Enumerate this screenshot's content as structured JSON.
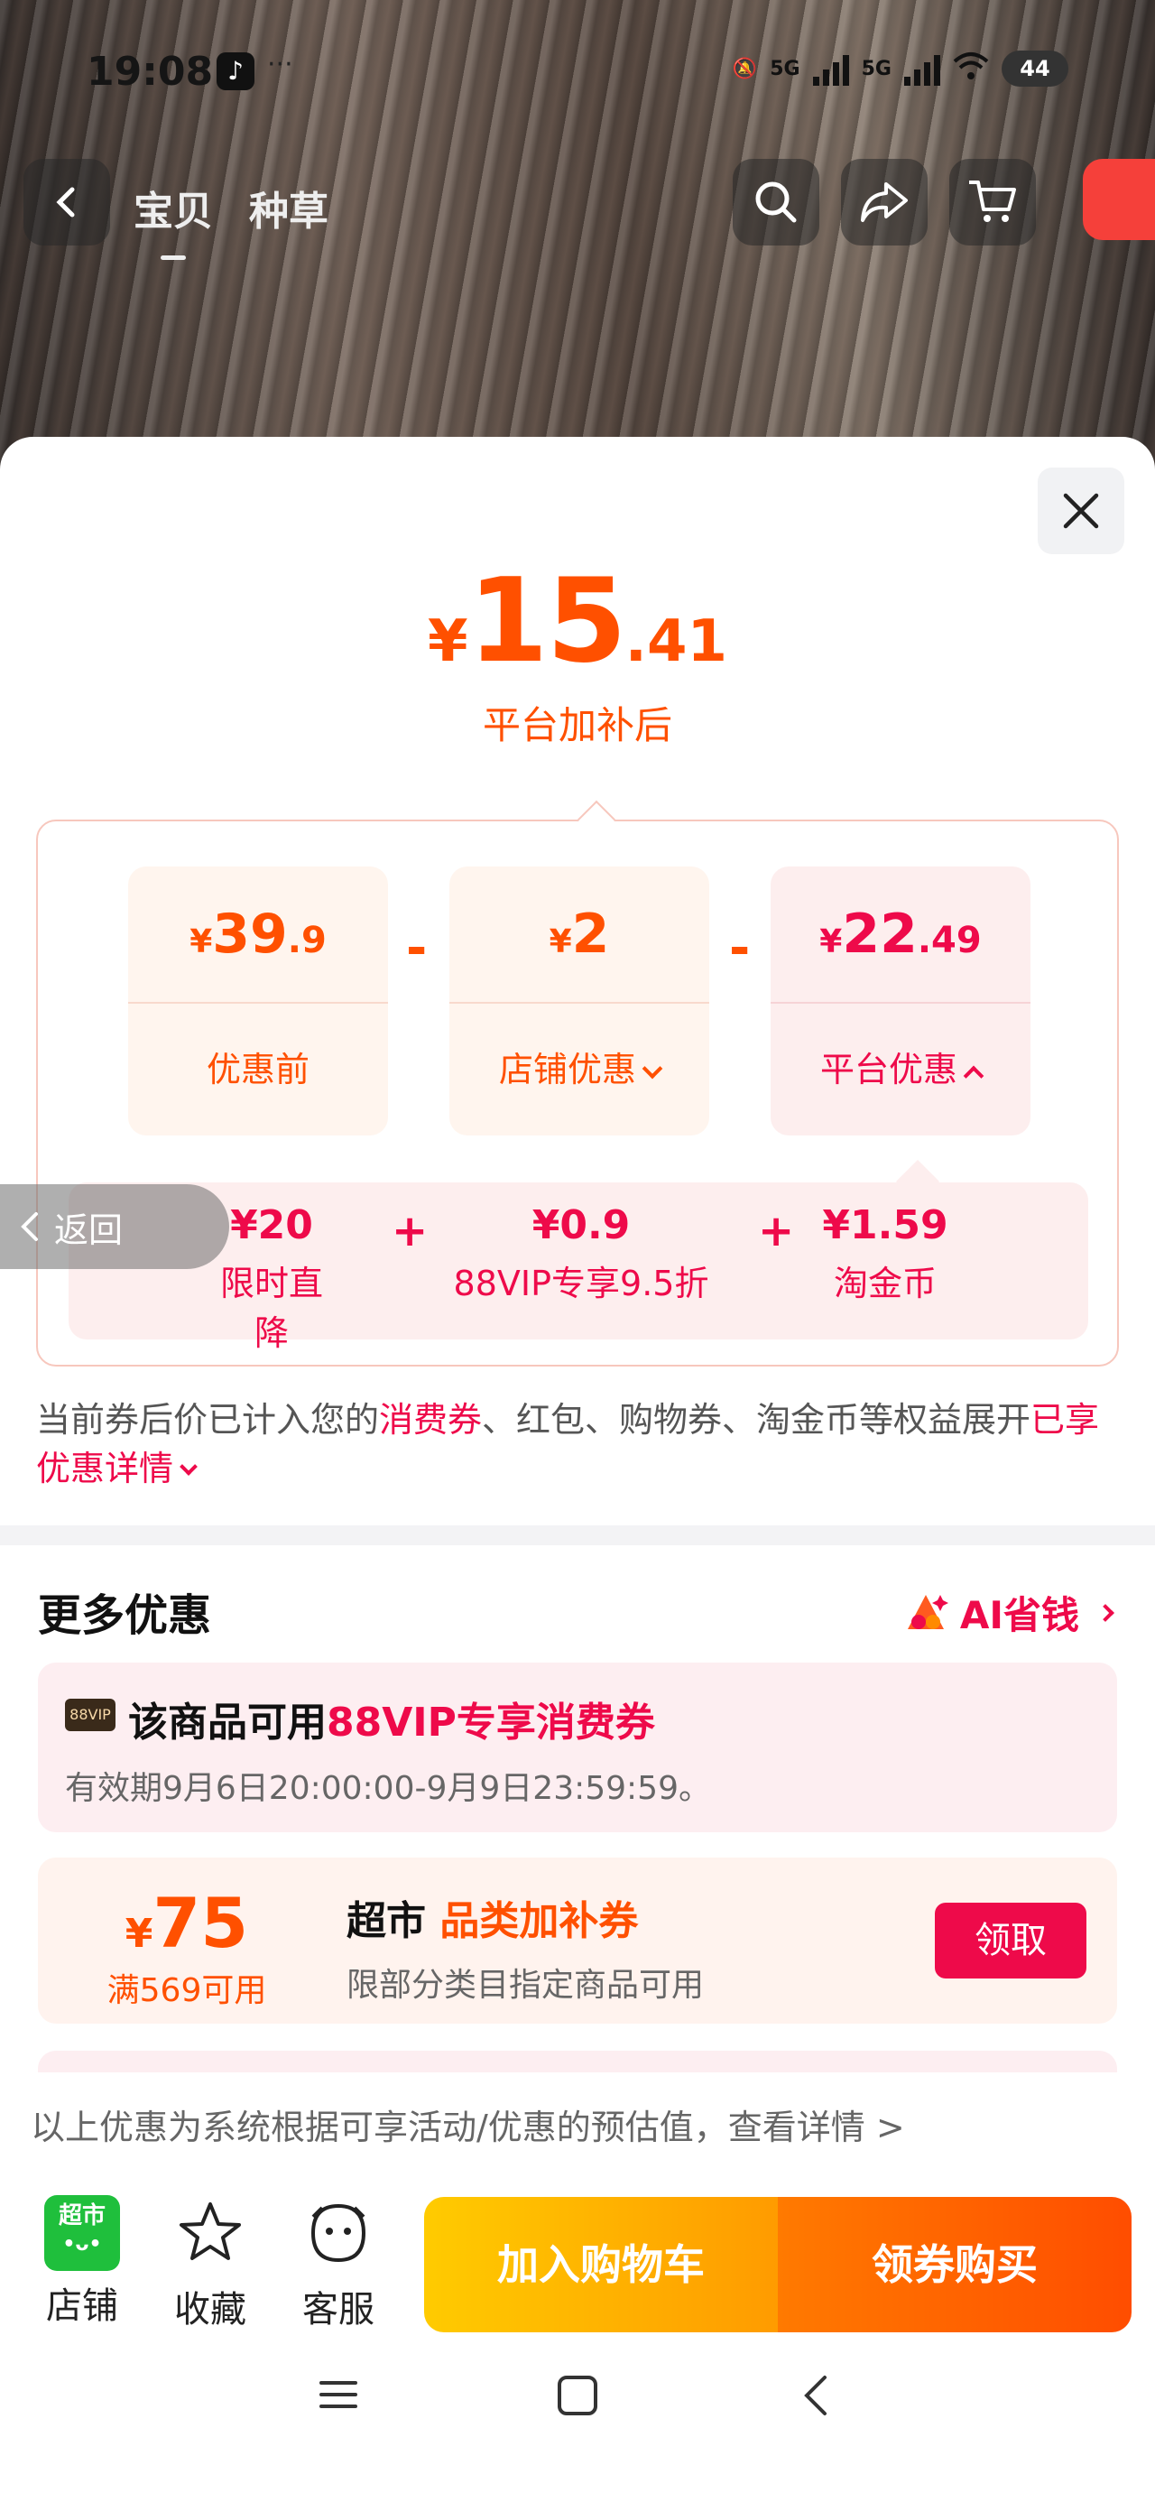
{
  "status_bar": {
    "time": "19:08",
    "app_icon": "tiktok-icon",
    "dots": "···",
    "net1": "5G",
    "net2": "5G",
    "battery": "44"
  },
  "nav": {
    "tab_item": "宝贝",
    "tab_grass": "种草"
  },
  "sheet": {
    "final_price": {
      "symbol": "¥",
      "integer": "15",
      "decimal": ".41",
      "label": "平台加补后"
    },
    "breakdown": {
      "original": {
        "symbol": "¥",
        "integer": "39",
        "decimal": ".9",
        "label": "优惠前"
      },
      "shop_discount": {
        "symbol": "¥",
        "integer": "2",
        "decimal": "",
        "label": "店铺优惠"
      },
      "platform_discount": {
        "symbol": "¥",
        "integer": "22",
        "decimal": ".49",
        "label": "平台优惠"
      },
      "minus": "-",
      "platform_items": [
        {
          "value": "¥20",
          "label": "限时直降"
        },
        {
          "value": "¥0.9",
          "label": "88VIP专享9.5折"
        },
        {
          "value": "¥1.59",
          "label": "淘金币"
        }
      ],
      "plus": "+"
    },
    "note": {
      "prefix": "当前券后价已计入您的",
      "highlight": "消费券",
      "middle": "、红包、购物券、淘金币等权益展开",
      "link": "已享优惠详情"
    },
    "more": {
      "title": "更多优惠",
      "ai_label": "AI省钱"
    },
    "back_label": "返回",
    "vip_coupon": {
      "tag": "88VIP",
      "title_prefix": "该商品可用",
      "title_highlight": "88VIP专享消费券",
      "validity": "有效期9月6日20:00:00-9月9日23:59:59。"
    },
    "category_coupon": {
      "symbol": "¥",
      "amount": "75",
      "condition": "满569可用",
      "title_prefix": "超市 ",
      "title_highlight": "品类加补券",
      "desc": "限部分类目指定商品可用",
      "button": "领取"
    },
    "disclaimer": "以上优惠为系统根据可享活动/优惠的预估值，查看详情 >"
  },
  "action_bar": {
    "shop_icon_text": "超市",
    "shop": "店铺",
    "favorite": "收藏",
    "service": "客服",
    "add_cart": "加入购物车",
    "buy": "领券购买"
  },
  "colors": {
    "accent_orange": "#ff5000",
    "accent_red": "#ee0a4a"
  }
}
